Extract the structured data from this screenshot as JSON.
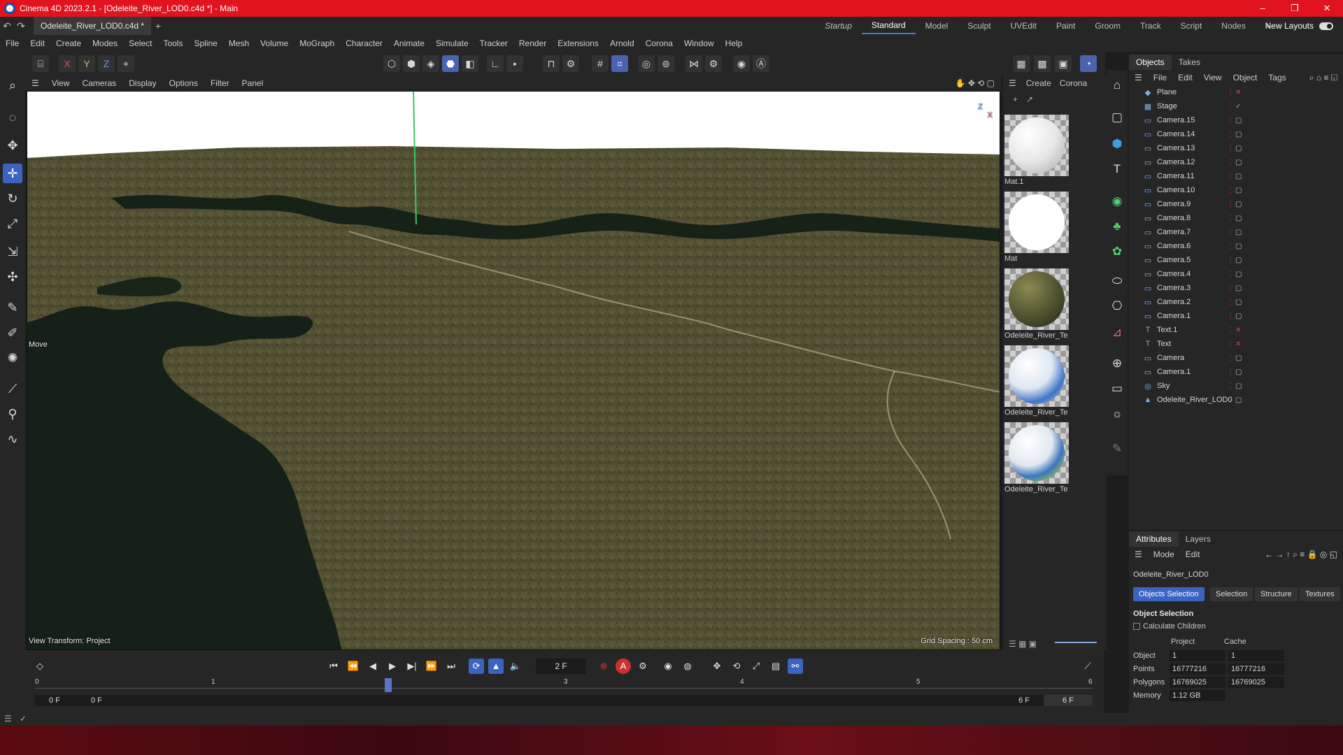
{
  "titlebar": {
    "title": "Cinema 4D 2023.2.1 - [Odeleite_River_LOD0.c4d *] - Main",
    "minimize": "–",
    "maximize": "❐",
    "close": "✕"
  },
  "tabbar": {
    "doc_tab": "Odeleite_River_LOD0.c4d *",
    "add": "+",
    "layouts": [
      "Startup",
      "Standard",
      "Model",
      "Sculpt",
      "UVEdit",
      "Paint",
      "Groom",
      "Track",
      "Script",
      "Nodes"
    ],
    "active_layout": "Standard",
    "new_layouts": "New Layouts"
  },
  "menu": [
    "File",
    "Edit",
    "Create",
    "Modes",
    "Select",
    "Tools",
    "Spline",
    "Mesh",
    "Volume",
    "MoGraph",
    "Character",
    "Animate",
    "Simulate",
    "Tracker",
    "Render",
    "Extensions",
    "Arnold",
    "Corona",
    "Window",
    "Help"
  ],
  "axis_buttons": [
    "X",
    "Y",
    "Z"
  ],
  "viewport": {
    "menu": [
      "View",
      "Cameras",
      "Display",
      "Options",
      "Filter",
      "Panel"
    ],
    "move_label": "Move",
    "view_transform": "View Transform: Project",
    "grid_spacing": "Grid Spacing : 50 cm",
    "axis_z": "Z",
    "axis_x": "X"
  },
  "materials": {
    "menu": [
      "Create",
      "Corona"
    ],
    "items": [
      {
        "name": "Mat.1",
        "kind": "white-matte"
      },
      {
        "name": "Mat",
        "kind": "white-flat"
      },
      {
        "name": "Odeleite_River_Te",
        "kind": "terrain"
      },
      {
        "name": "Odeleite_River_Te",
        "kind": "water-blue"
      },
      {
        "name": "Odeleite_River_Te",
        "kind": "water-blue-green"
      }
    ]
  },
  "objects_panel": {
    "tabs": [
      "Objects",
      "Takes"
    ],
    "menu": [
      "File",
      "Edit",
      "View",
      "Object",
      "Tags"
    ],
    "items": [
      {
        "name": "Plane",
        "icon": "plane-icon",
        "flag": "red-x"
      },
      {
        "name": "Stage",
        "icon": "stage-icon",
        "flag": "green-check"
      },
      {
        "name": "Camera.15",
        "icon": "camera-icon",
        "flag": "dot"
      },
      {
        "name": "Camera.14",
        "icon": "camera-icon",
        "flag": "dot"
      },
      {
        "name": "Camera.13",
        "icon": "camera-icon",
        "flag": "dot"
      },
      {
        "name": "Camera.12",
        "icon": "camera-icon",
        "flag": "dot"
      },
      {
        "name": "Camera.11",
        "icon": "camera-icon",
        "flag": "dot"
      },
      {
        "name": "Camera.10",
        "icon": "camera-icon",
        "flag": "dot"
      },
      {
        "name": "Camera.9",
        "icon": "camera-icon",
        "flag": "dot"
      },
      {
        "name": "Camera.8",
        "icon": "camera-icon",
        "flag": "dot"
      },
      {
        "name": "Camera.7",
        "icon": "camera-icon",
        "flag": "dot"
      },
      {
        "name": "Camera.6",
        "icon": "camera-icon",
        "flag": "dot"
      },
      {
        "name": "Camera.5",
        "icon": "camera-icon",
        "flag": "dot"
      },
      {
        "name": "Camera.4",
        "icon": "camera-icon",
        "flag": "dot"
      },
      {
        "name": "Camera.3",
        "icon": "camera-icon",
        "flag": "dot"
      },
      {
        "name": "Camera.2",
        "icon": "camera-icon",
        "flag": "dot"
      },
      {
        "name": "Camera.1",
        "icon": "camera-icon",
        "flag": "dot"
      },
      {
        "name": "Text.1",
        "icon": "text-icon",
        "flag": "red-x"
      },
      {
        "name": "Text",
        "icon": "text-icon",
        "flag": "red-x"
      },
      {
        "name": "Camera",
        "icon": "camera-icon",
        "flag": "dot"
      },
      {
        "name": "Camera.1",
        "icon": "camera-icon",
        "flag": "dot"
      },
      {
        "name": "Sky",
        "icon": "sky-icon",
        "flag": "dot"
      },
      {
        "name": "Odeleite_River_LOD0",
        "icon": "polygon-icon",
        "flag": "dot"
      }
    ]
  },
  "attributes": {
    "tabs": [
      "Attributes",
      "Layers"
    ],
    "menu": [
      "Mode",
      "Edit"
    ],
    "object_name": "Odeleite_River_LOD0",
    "buttons": [
      "Objects Selection",
      "Selection",
      "Structure",
      "Textures"
    ],
    "active_button": "Objects Selection",
    "section_title": "Object Selection",
    "calculate_children": "Calculate Children",
    "col_project": "Project",
    "col_cache": "Cache",
    "rows": [
      {
        "label": "Object",
        "project": "1",
        "cache": "1"
      },
      {
        "label": "Points",
        "project": "16777216",
        "cache": "16777216"
      },
      {
        "label": "Polygons",
        "project": "16769025",
        "cache": "16769025"
      },
      {
        "label": "Memory",
        "project": "1.12 GB",
        "cache": ""
      }
    ]
  },
  "timeline": {
    "current_frame": "2 F",
    "ticks": [
      "0",
      "1",
      "2",
      "3",
      "4",
      "5",
      "6"
    ],
    "playhead_frame": 2,
    "max_frame": 6,
    "start": "0 F",
    "range_start": "0 F",
    "range_end": "6 F",
    "end": "6 F"
  }
}
